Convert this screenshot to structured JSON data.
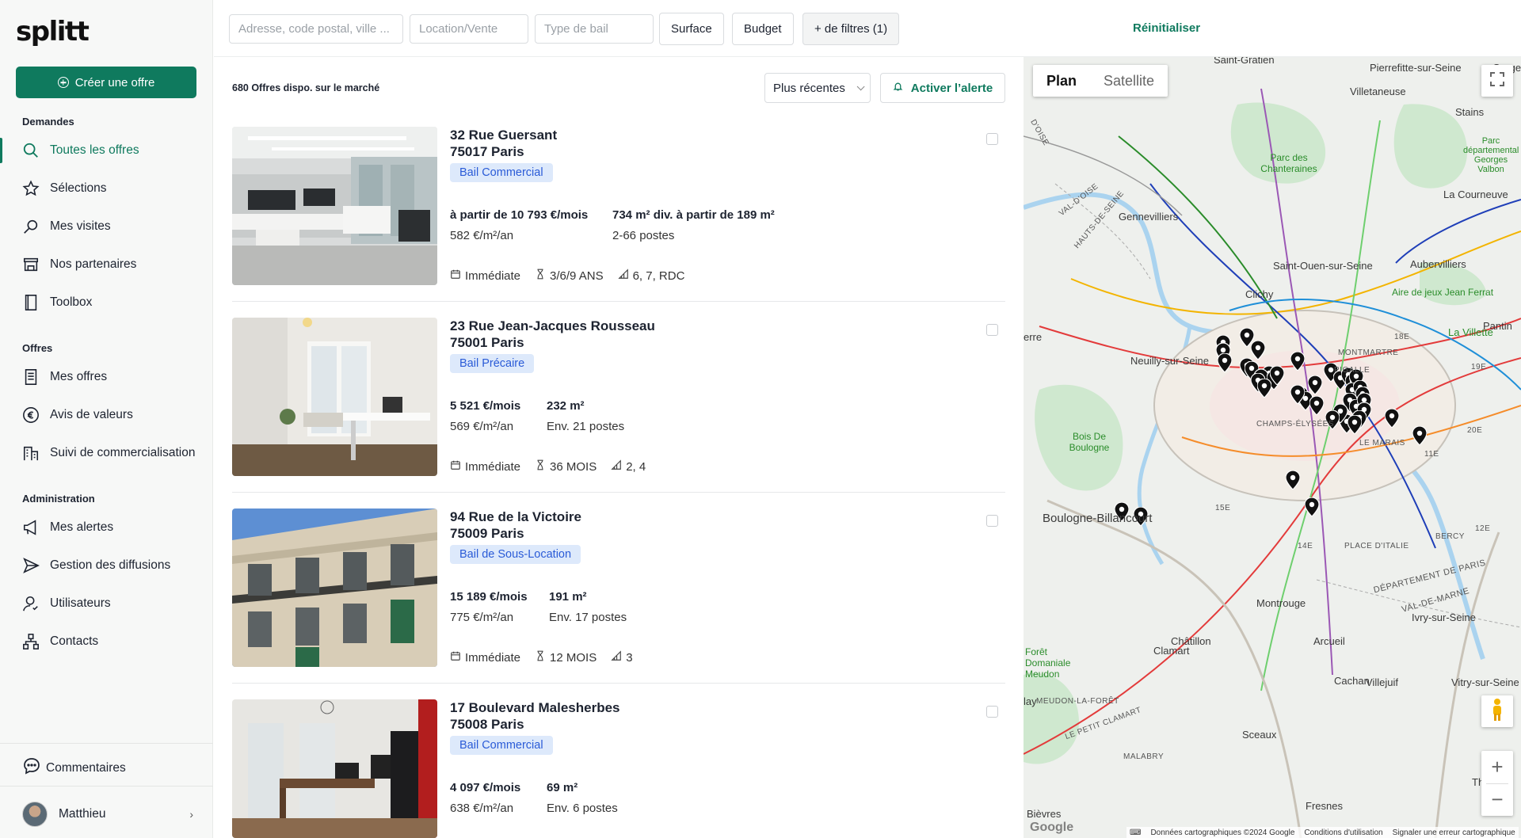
{
  "brand": {
    "logo_text": "splitt",
    "accent": "#0f7a5e"
  },
  "sidebar": {
    "create_label": "Créer une offre",
    "sections": [
      {
        "title": "Demandes"
      },
      {
        "title": "Offres"
      },
      {
        "title": "Administration"
      }
    ],
    "items": [
      {
        "label": "Toutes les offres",
        "icon": "search-icon",
        "active": true
      },
      {
        "label": "Sélections",
        "icon": "star-icon"
      },
      {
        "label": "Mes visites",
        "icon": "magnifier-icon"
      },
      {
        "label": "Nos partenaires",
        "icon": "store-icon"
      },
      {
        "label": "Toolbox",
        "icon": "book-icon"
      },
      {
        "label": "Mes offres",
        "icon": "document-icon"
      },
      {
        "label": "Avis de valeurs",
        "icon": "euro-icon"
      },
      {
        "label": "Suivi de commercialisation",
        "icon": "building-icon"
      },
      {
        "label": "Mes alertes",
        "icon": "megaphone-icon"
      },
      {
        "label": "Gestion des diffusions",
        "icon": "send-icon"
      },
      {
        "label": "Utilisateurs",
        "icon": "user-icon"
      },
      {
        "label": "Contacts",
        "icon": "network-icon"
      }
    ],
    "comments_label": "Commentaires",
    "user_name": "Matthieu"
  },
  "filters": {
    "address_placeholder": "Adresse, code postal, ville ...",
    "type_placeholder": "Location/Vente",
    "lease_placeholder": "Type de bail",
    "surface_label": "Surface",
    "budget_label": "Budget",
    "more_filters_label": "+ de filtres (1)",
    "reset_label": "Réinitialiser"
  },
  "listing": {
    "count_text": "680 Offres dispo. sur le marché",
    "sort_value": "Plus récentes",
    "alert_label": "Activer l’alerte",
    "offers": [
      {
        "street": "32 Rue Guersant",
        "city": "75017 Paris",
        "lease": "Bail Commercial",
        "price": "à partir de 10 793 €/mois",
        "price_m2": "582 €/m²/an",
        "area": "734 m² div. à partir de 189 m²",
        "posts": "2-66 postes",
        "availability": "Immédiate",
        "duration": "3/6/9 ANS",
        "floors": "6, 7, RDC"
      },
      {
        "street": "23 Rue Jean-Jacques Rousseau",
        "city": "75001 Paris",
        "lease": "Bail Précaire",
        "price": "5 521 €/mois",
        "price_m2": "569 €/m²/an",
        "area": "232 m²",
        "posts": "Env. 21 postes",
        "availability": "Immédiate",
        "duration": "36 MOIS",
        "floors": "2, 4"
      },
      {
        "street": "94 Rue de la Victoire",
        "city": "75009 Paris",
        "lease": "Bail de Sous-Location",
        "price": "15 189 €/mois",
        "price_m2": "775 €/m²/an",
        "area": "191 m²",
        "posts": "Env. 17 postes",
        "availability": "Immédiate",
        "duration": "12 MOIS",
        "floors": "3"
      },
      {
        "street": "17 Boulevard Malesherbes",
        "city": "75008 Paris",
        "lease": "Bail Commercial",
        "price": "4 097 €/mois",
        "price_m2": "638 €/m²/an",
        "area": "69 m²",
        "posts": "Env. 6 postes",
        "availability": "",
        "duration": "",
        "floors": ""
      }
    ]
  },
  "map": {
    "tab_plan": "Plan",
    "tab_satellite": "Satellite",
    "labels": {
      "saint_gratien": "Saint-Gratien",
      "pierrefitte": "Pierrefitte-sur-Seine",
      "garges": "Garges",
      "villetaneuse": "Villetaneuse",
      "stains": "Stains",
      "parc_courneuve": "Parc départemental Georges Valbon",
      "la_courneuve": "La Courneuve",
      "parc_chanteraines": "Parc des Chanteraines",
      "gennevilliers": "Gennevilliers",
      "saint_ouen": "Saint-Ouen-sur-Seine",
      "aubervilliers": "Aubervilliers",
      "clichy": "Clichy",
      "aire_jeux": "Aire de jeux Jean Ferrat",
      "val_doise": "VAL-D'OISE",
      "hauts_de_seine": "HAUTS-DE-SEINE",
      "doise": "D'OISE",
      "neuilly": "Neuilly-sur-Seine",
      "montmartre": "MONTMARTRE",
      "pigalle": "PIGALLE",
      "la_villette": "La Villette",
      "pantin": "Pantin",
      "erre": "erre",
      "champs": "CHAMPS-ÉLYSÉES",
      "le_marais": "LE MARAIS",
      "bois_boulogne": "Bois De Boulogne",
      "arr_18": "18E",
      "arr_19": "19E",
      "arr_20": "20E",
      "arr_11": "11E",
      "arr_15": "15E",
      "arr_14": "14E",
      "arr_12": "12E",
      "boulogne": "Boulogne-Billancourt",
      "bercy": "BERCY",
      "place_italie": "PLACE D'ITALIE",
      "dept_paris": "DÉPARTEMENT DE PARIS",
      "montrouge": "Montrouge",
      "val_de_marne": "VAL-DE-MARNE",
      "ivry": "Ivry-sur-Seine",
      "chatillon": "Châtillon",
      "arcueil": "Arcueil",
      "clamart": "Clamart",
      "foret": "Forêt Domaniale Meudon",
      "meudon_foret": "MEUDON-LA-FORÊT",
      "lay": "lay",
      "cachan": "Cachan",
      "villejuif": "Villejuif",
      "vitry": "Vitry-sur-Seine",
      "le_petit_clamart": "LE PETIT CLAMART",
      "sceaux": "Sceaux",
      "malabry": "MALABRY",
      "thiais": "Thiais",
      "bievres": "Bièvres",
      "fresnes": "Fresnes"
    },
    "footer": {
      "data": "Données cartographiques ©2024 Google",
      "terms": "Conditions d'utilisation",
      "report": "Signaler une erreur cartographique"
    },
    "google_logo": "Google",
    "pin_count": 42
  }
}
